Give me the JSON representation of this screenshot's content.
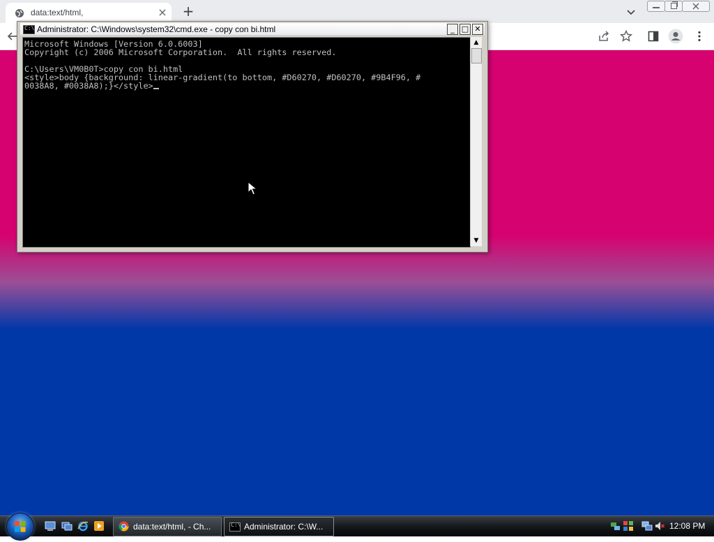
{
  "browser": {
    "tab_title": "data:text/html,",
    "new_tab": "+",
    "tab_close": "×"
  },
  "page": {
    "background_colors": [
      "#D60270",
      "#D60270",
      "#9B4F96",
      "#0038A8",
      "#0038A8"
    ]
  },
  "cmd": {
    "title": "Administrator: C:\\Windows\\system32\\cmd.exe - copy  con bi.html",
    "icon_text": "C:\\",
    "lines": [
      "Microsoft Windows [Version 6.0.6003]",
      "Copyright (c) 2006 Microsoft Corporation.  All rights reserved.",
      "",
      "C:\\Users\\VM0B0T>copy con bi.html",
      "<style>body {background: linear-gradient(to bottom, #D60270, #D60270, #9B4F96, #",
      "0038A8, #0038A8);}</style>"
    ],
    "minimize": "_",
    "maximize": "□",
    "close": "✕",
    "scroll_up": "▲",
    "scroll_down": "▼"
  },
  "taskbar": {
    "buttons": [
      {
        "label": "data:text/html, - Ch..."
      },
      {
        "label": "Administrator: C:\\W..."
      }
    ],
    "clock": "12:08 PM"
  },
  "colors": {
    "chrome_bg": "#e9ebee",
    "console_bg": "#000000",
    "console_fg": "#c0c0c0"
  }
}
